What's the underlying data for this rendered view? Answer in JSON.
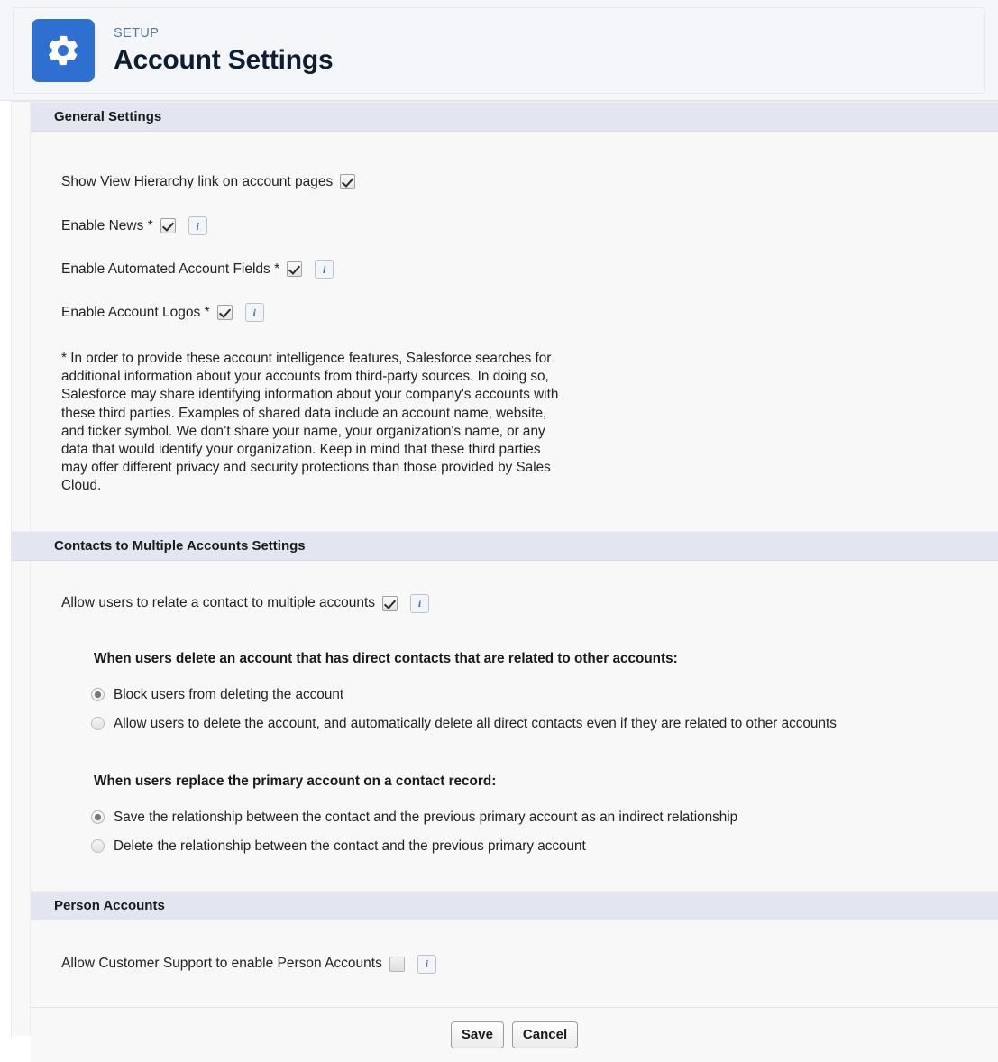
{
  "header": {
    "eyebrow": "SETUP",
    "title": "Account Settings",
    "icon": "gear-icon"
  },
  "sections": {
    "general": {
      "title": "General Settings",
      "settings": [
        {
          "label": "Show View Hierarchy link on account pages",
          "checked": true,
          "has_info": false
        },
        {
          "label": "Enable News *",
          "checked": true,
          "has_info": true
        },
        {
          "label": "Enable Automated Account Fields *",
          "checked": true,
          "has_info": true
        },
        {
          "label": "Enable Account Logos *",
          "checked": true,
          "has_info": true
        }
      ],
      "disclaimer": "* In order to provide these account intelligence features, Salesforce searches for additional information about your accounts from third-party sources. In doing so, Salesforce may share identifying information about your company's accounts with these third parties. Examples of shared data include an account name, website, and ticker symbol. We don’t share your name, your organization's name, or any data that would identify your organization. Keep in mind that these third parties may offer different privacy and security protections than those provided by Sales Cloud."
    },
    "contacts": {
      "title": "Contacts to Multiple Accounts Settings",
      "allow_multiple": {
        "label": "Allow users to relate a contact to multiple accounts",
        "checked": true,
        "has_info": true
      },
      "delete_group": {
        "heading": "When users delete an account that has direct contacts that are related to other accounts:",
        "options": [
          {
            "label": "Block users from deleting the account",
            "selected": true
          },
          {
            "label": "Allow users to delete the account, and automatically delete all direct contacts even if they are related to other accounts",
            "selected": false
          }
        ]
      },
      "replace_group": {
        "heading": "When users replace the primary account on a contact record:",
        "options": [
          {
            "label": "Save the relationship between the contact and the previous primary account as an indirect relationship",
            "selected": true
          },
          {
            "label": "Delete the relationship between the contact and the previous primary account",
            "selected": false
          }
        ]
      }
    },
    "person_accounts": {
      "title": "Person Accounts",
      "settings": [
        {
          "label": "Allow Customer Support to enable Person Accounts",
          "checked": false,
          "has_info": true
        }
      ]
    }
  },
  "footer": {
    "save_label": "Save",
    "cancel_label": "Cancel"
  },
  "colors": {
    "brand_blue": "#2e6fd0",
    "section_bar": "#e3e5f0",
    "panel_bg": "#f8f8f8",
    "info_blue": "#3b6fc4"
  }
}
